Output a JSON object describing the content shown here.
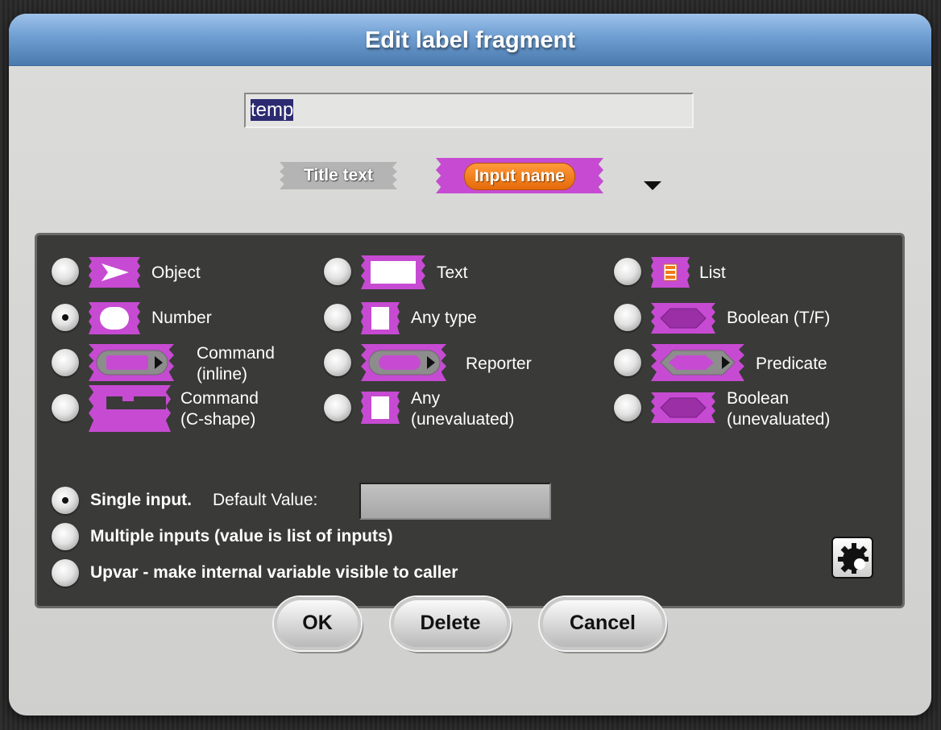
{
  "dialog": {
    "title": "Edit label fragment"
  },
  "name_field": {
    "value": "temp"
  },
  "fragment_types": {
    "title_text": "Title text",
    "input_name": "Input name"
  },
  "input_types": [
    {
      "label": "Object",
      "selected": false
    },
    {
      "label": "Text",
      "selected": false
    },
    {
      "label": "List",
      "selected": false
    },
    {
      "label": "Number",
      "selected": true
    },
    {
      "label": "Any type",
      "selected": false
    },
    {
      "label": "Boolean (T/F)",
      "selected": false
    },
    {
      "label": "Command\n(inline)",
      "selected": false
    },
    {
      "label": "Reporter",
      "selected": false
    },
    {
      "label": "Predicate",
      "selected": false
    },
    {
      "label": "Command\n(C-shape)",
      "selected": false
    },
    {
      "label": "Any\n(unevaluated)",
      "selected": false
    },
    {
      "label": "Boolean\n(unevaluated)",
      "selected": false
    }
  ],
  "arity": {
    "single_label": "Single input.",
    "default_value_label": "Default Value:",
    "default_value": "",
    "multiple_label": "Multiple inputs (value is list of inputs)",
    "upvar_label": "Upvar - make internal variable visible to caller",
    "selected": "single"
  },
  "buttons": {
    "ok": "OK",
    "delete": "Delete",
    "cancel": "Cancel"
  },
  "icons": [
    "dropdown-arrow-icon",
    "gear-icon"
  ],
  "colors": {
    "title_bar": "#6e9ed2",
    "slot_magenta": "#c64bd2",
    "input_name_orange": "#f07a1a",
    "panel": "#3a3a38"
  }
}
